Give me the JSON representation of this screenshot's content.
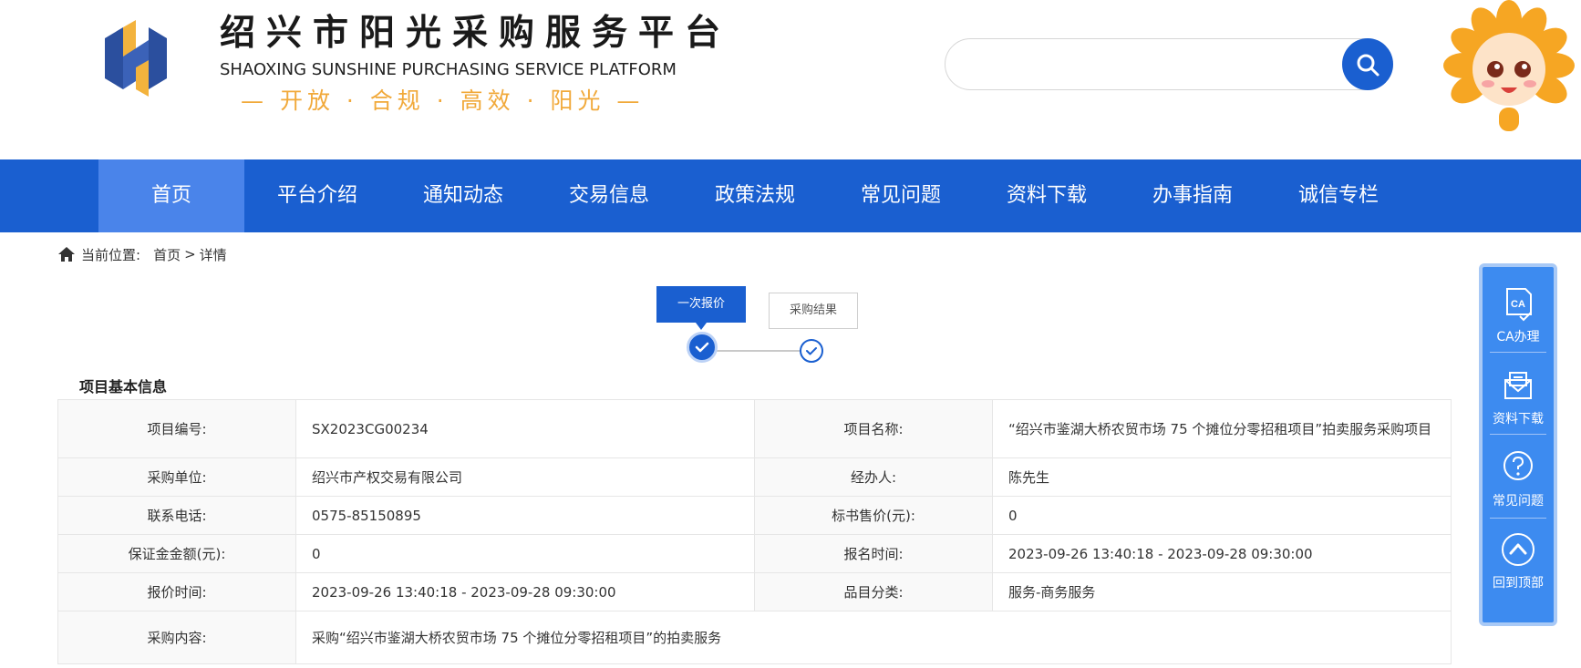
{
  "header": {
    "title": "绍兴市阳光采购服务平台",
    "subtitle": "SHAOXING SUNSHINE PURCHASING SERVICE PLATFORM",
    "slogan": "— 开放 · 合规 · 高效 · 阳光 —",
    "search": {
      "placeholder": ""
    },
    "colors": {
      "brand": "#1a5fd0",
      "slogan": "#f1a93a"
    }
  },
  "nav": {
    "items": [
      {
        "label": "首页",
        "active": true
      },
      {
        "label": "平台介绍"
      },
      {
        "label": "通知动态"
      },
      {
        "label": "交易信息"
      },
      {
        "label": "政策法规"
      },
      {
        "label": "常见问题"
      },
      {
        "label": "资料下载"
      },
      {
        "label": "办事指南"
      },
      {
        "label": "诚信专栏"
      }
    ]
  },
  "breadcrumb": {
    "prefix": "当前位置:",
    "home": "首页",
    "separator": ">",
    "current": "详情"
  },
  "steps": [
    {
      "label": "一次报价",
      "done": true
    },
    {
      "label": "采购结果",
      "done": false
    }
  ],
  "section": {
    "title": "项目基本信息"
  },
  "info": {
    "rows": [
      {
        "l1": "项目编号:",
        "v1": "SX2023CG00234",
        "l2": "项目名称:",
        "v2": "“绍兴市鉴湖大桥农贸市场 75 个摊位分零招租项目”拍卖服务采购项目"
      },
      {
        "l1": "采购单位:",
        "v1": "绍兴市产权交易有限公司",
        "l2": "经办人:",
        "v2": "陈先生"
      },
      {
        "l1": "联系电话:",
        "v1": "0575-85150895",
        "l2": "标书售价(元):",
        "v2": "0"
      },
      {
        "l1": "保证金金额(元):",
        "v1": "0",
        "l2": "报名时间:",
        "v2": "2023-09-26 13:40:18 - 2023-09-28 09:30:00"
      },
      {
        "l1": "报价时间:",
        "v1": "2023-09-26 13:40:18 - 2023-09-28 09:30:00",
        "l2": "品目分类:",
        "v2": "服务-商务服务"
      }
    ],
    "content_label": "采购内容:",
    "content_value": "采购“绍兴市鉴湖大桥农贸市场 75 个摊位分零招租项目”的拍卖服务"
  },
  "float_panel": {
    "items": [
      {
        "label": "CA办理",
        "icon": "ca-icon"
      },
      {
        "label": "资料下载",
        "icon": "download-mail-icon"
      },
      {
        "label": "常见问题",
        "icon": "question-icon"
      },
      {
        "label": "回到顶部",
        "icon": "back-to-top-icon"
      }
    ]
  }
}
